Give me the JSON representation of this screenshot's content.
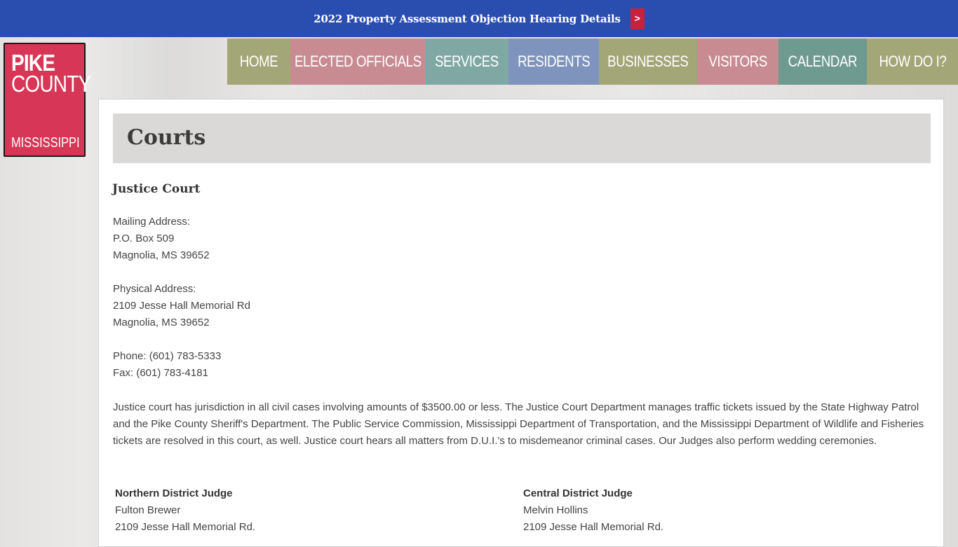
{
  "banner": {
    "text": "2022 Property Assessment Objection Hearing Details",
    "arrow": ">"
  },
  "logo": {
    "line1": "PIKE",
    "line2": "COUNTY",
    "line3": "MISSISSIPPI"
  },
  "nav": [
    {
      "label": "HOME",
      "color": "#a3a676"
    },
    {
      "label": "ELECTED OFFICIALS",
      "color": "#c98b92"
    },
    {
      "label": "SERVICES",
      "color": "#7fa8a5"
    },
    {
      "label": "RESIDENTS",
      "color": "#7f94bd"
    },
    {
      "label": "BUSINESSES",
      "color": "#a3a676"
    },
    {
      "label": "VISITORS",
      "color": "#c98b92"
    },
    {
      "label": "CALENDAR",
      "color": "#6f9a8f"
    },
    {
      "label": "HOW DO I?",
      "color": "#a3a676"
    }
  ],
  "page": {
    "title": "Courts",
    "section": "Justice Court",
    "mailing": {
      "label": "Mailing Address:",
      "line1": "P.O. Box 509",
      "line2": "Magnolia, MS 39652"
    },
    "physical": {
      "label": "Physical Address:",
      "line1": "2109 Jesse Hall Memorial Rd",
      "line2": "Magnolia, MS 39652"
    },
    "phone": "Phone: (601) 783-5333",
    "fax": "Fax: (601) 783-4181",
    "description": "Justice court has jurisdiction in all civil cases involving amounts of $3500.00 or less. The Justice Court Department manages traffic tickets issued by the State Highway Patrol and the Pike County Sheriff's Department. The Public Service Commission, Mississippi Department of Transportation, and the Mississippi Department of Wildlife and Fisheries tickets are resolved in this court, as well. Justice court hears all matters from D.U.I.'s to misdemeanor criminal cases. Our Judges also perform wedding ceremonies.",
    "judges": [
      {
        "title": "Northern District Judge",
        "name": "Fulton Brewer",
        "address": "2109 Jesse Hall Memorial Rd."
      },
      {
        "title": "Central District Judge",
        "name": "Melvin Hollins",
        "address": "2109 Jesse Hall Memorial Rd."
      }
    ]
  }
}
